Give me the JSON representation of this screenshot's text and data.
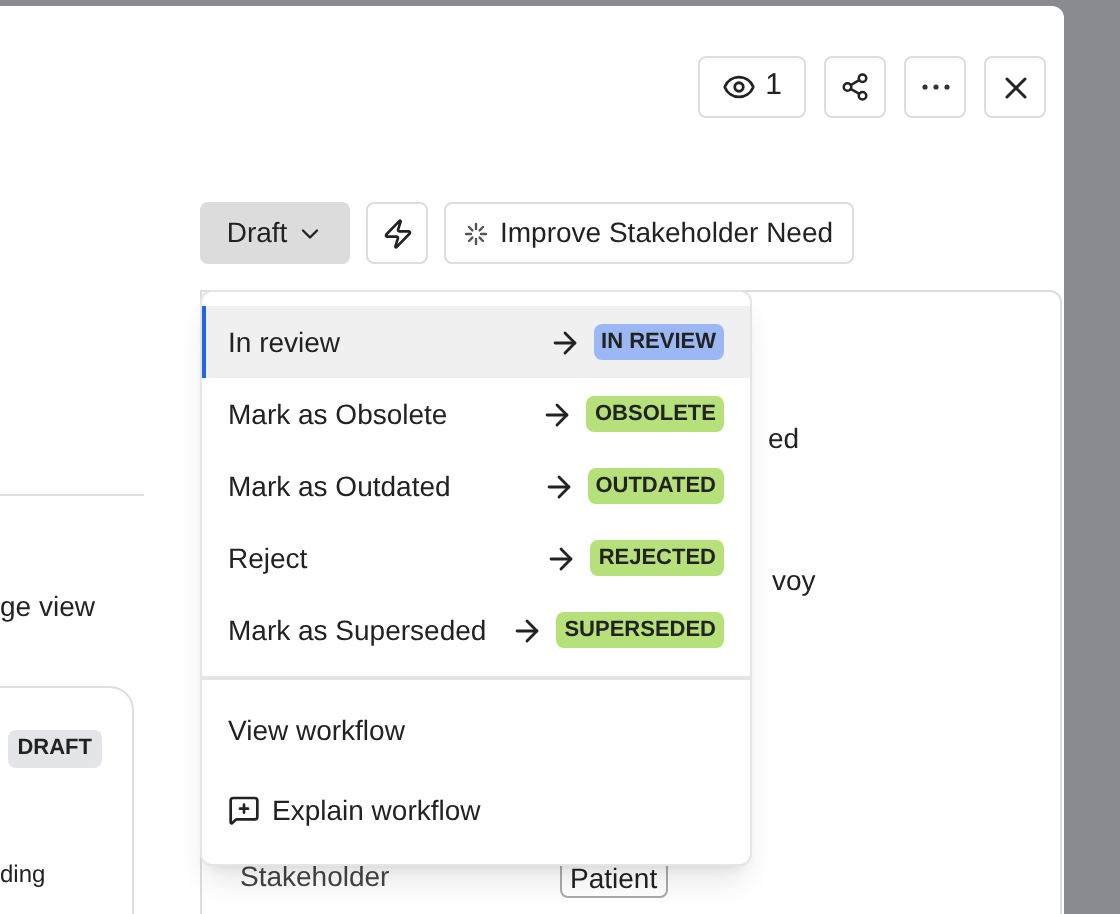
{
  "header": {
    "view_count": "1"
  },
  "toolbar": {
    "status": "Draft",
    "improve_button": "Improve Stakeholder Need"
  },
  "left_panel": {
    "text": "ge view",
    "card_badge": "DRAFT",
    "card_text": "ding"
  },
  "detail_card": {
    "fragments": [
      "ed",
      "voy"
    ],
    "field_label": "Stakeholder",
    "field_value": "Patient"
  },
  "status_menu": {
    "transitions": [
      {
        "label": "In review",
        "target": "IN REVIEW",
        "color": "#9bb8f5",
        "selected": true
      },
      {
        "label": "Mark as Obsolete",
        "target": "OBSOLETE",
        "color": "#b5e07a",
        "selected": false
      },
      {
        "label": "Mark as Outdated",
        "target": "OUTDATED",
        "color": "#b5e07a",
        "selected": false
      },
      {
        "label": "Reject",
        "target": "REJECTED",
        "color": "#b5e07a",
        "selected": false
      },
      {
        "label": "Mark as Superseded",
        "target": "SUPERSEDED",
        "color": "#b5e07a",
        "selected": false
      }
    ],
    "actions": [
      {
        "label": "View workflow",
        "kind": "plain"
      },
      {
        "label": "Explain workflow",
        "kind": "ai"
      }
    ]
  }
}
